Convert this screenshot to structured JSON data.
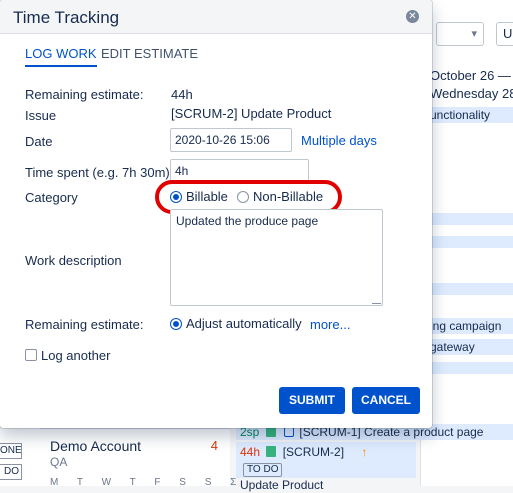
{
  "background": {
    "select_right_label": "U",
    "date_range_line1": "October 26 — N",
    "date_range_line2": "Wednesday 28",
    "cells": [
      "unctionality",
      "ing campaign",
      "gateway"
    ],
    "left_button_labels": [
      "ONE",
      "DO"
    ],
    "person": {
      "name": "Demo Account",
      "role": "QA",
      "count": "4",
      "weekdays": "M T W T F S S Σ"
    },
    "issue_row_1": {
      "points": "2sp",
      "text": "[SCRUM-1] Create a product page"
    },
    "issue_row_2": {
      "estimate": "44h",
      "key": "[SCRUM-2]",
      "status": "TO DO",
      "title": "Update Product"
    }
  },
  "dialog": {
    "title": "Time Tracking",
    "tabs": [
      {
        "label": "LOG WORK",
        "active": true
      },
      {
        "label": "EDIT ESTIMATE",
        "active": false
      }
    ],
    "remaining_estimate": {
      "label": "Remaining estimate:",
      "value": "44h"
    },
    "issue": {
      "label": "Issue",
      "value": "[SCRUM-2] Update Product"
    },
    "date": {
      "label": "Date",
      "value": "2020-10-26 15:06",
      "link": "Multiple days"
    },
    "time_spent": {
      "label": "Time spent (e.g. 7h 30m)",
      "value": "4h"
    },
    "category": {
      "label": "Category",
      "options": [
        "Billable",
        "Non-Billable"
      ],
      "selected": "Billable"
    },
    "work_description": {
      "label": "Work description",
      "value": "Updated the produce page"
    },
    "remaining_adjust": {
      "label": "Remaining estimate:",
      "option": "Adjust automatically",
      "link": "more..."
    },
    "log_another": {
      "label": "Log another",
      "checked": false
    },
    "buttons": {
      "submit": "SUBMIT",
      "cancel": "CANCEL"
    }
  },
  "colors": {
    "primary": "#0052cc",
    "highlight": "#e00000",
    "cell_bg": "#deebff"
  }
}
